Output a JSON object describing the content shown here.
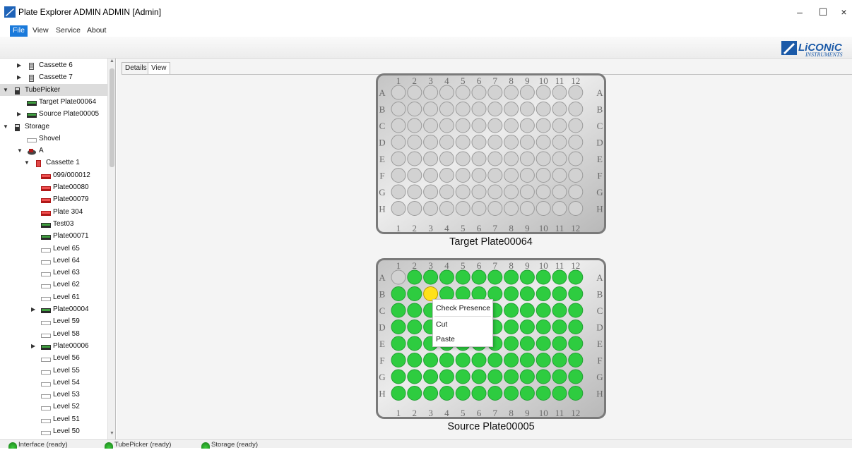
{
  "window": {
    "title": "Plate Explorer ADMIN ADMIN [Admin]",
    "minimize": "–",
    "maximize": "☐",
    "close": "×"
  },
  "menu": [
    "File",
    "View",
    "Service",
    "About"
  ],
  "logo": {
    "brand": "LiCONiC",
    "sub": "INSTRUMENTS"
  },
  "tree": [
    {
      "label": "Cassette 6",
      "level": 2,
      "arrow": "right",
      "icon": "cassette-icon"
    },
    {
      "label": "Cassette 7",
      "level": 2,
      "arrow": "right",
      "icon": "cassette-icon"
    },
    {
      "label": "TubePicker",
      "level": 1,
      "arrow": "down",
      "icon": "device-icon",
      "selected": true
    },
    {
      "label": "Target Plate00064",
      "level": 2,
      "arrow": "none",
      "icon": "plate-dark-icon"
    },
    {
      "label": "Source Plate00005",
      "level": 2,
      "arrow": "right",
      "icon": "plate-dark-icon"
    },
    {
      "label": "Storage",
      "level": 1,
      "arrow": "down",
      "icon": "device-icon"
    },
    {
      "label": "Shovel",
      "level": 2,
      "arrow": "none",
      "icon": "level-empty-icon"
    },
    {
      "label": "A",
      "level": 2,
      "arrow": "down",
      "icon": "carousel-icon"
    },
    {
      "label": "Cassette 1",
      "level": 3,
      "arrow": "down",
      "icon": "cassette-red-icon"
    },
    {
      "label": "099/000012",
      "level": 4,
      "arrow": "none",
      "icon": "plate-red-icon"
    },
    {
      "label": "Plate00080",
      "level": 4,
      "arrow": "none",
      "icon": "plate-red-icon"
    },
    {
      "label": "Plate00079",
      "level": 4,
      "arrow": "none",
      "icon": "plate-red-icon"
    },
    {
      "label": "Plate 304",
      "level": 4,
      "arrow": "none",
      "icon": "plate-red-icon"
    },
    {
      "label": "Test03",
      "level": 4,
      "arrow": "none",
      "icon": "plate-dark-icon"
    },
    {
      "label": "Plate00071",
      "level": 4,
      "arrow": "none",
      "icon": "plate-dark-icon"
    },
    {
      "label": "Level 65",
      "level": 4,
      "arrow": "none",
      "icon": "level-empty-icon"
    },
    {
      "label": "Level 64",
      "level": 4,
      "arrow": "none",
      "icon": "level-empty-icon"
    },
    {
      "label": "Level 63",
      "level": 4,
      "arrow": "none",
      "icon": "level-empty-icon"
    },
    {
      "label": "Level 62",
      "level": 4,
      "arrow": "none",
      "icon": "level-empty-icon"
    },
    {
      "label": "Level 61",
      "level": 4,
      "arrow": "none",
      "icon": "level-empty-icon"
    },
    {
      "label": "Plate00004",
      "level": 4,
      "arrow": "right",
      "icon": "plate-dark-icon"
    },
    {
      "label": "Level 59",
      "level": 4,
      "arrow": "none",
      "icon": "level-empty-icon"
    },
    {
      "label": "Level 58",
      "level": 4,
      "arrow": "none",
      "icon": "level-empty-icon"
    },
    {
      "label": "Plate00006",
      "level": 4,
      "arrow": "right",
      "icon": "plate-dark-icon"
    },
    {
      "label": "Level 56",
      "level": 4,
      "arrow": "none",
      "icon": "level-empty-icon"
    },
    {
      "label": "Level 55",
      "level": 4,
      "arrow": "none",
      "icon": "level-empty-icon"
    },
    {
      "label": "Level 54",
      "level": 4,
      "arrow": "none",
      "icon": "level-empty-icon"
    },
    {
      "label": "Level 53",
      "level": 4,
      "arrow": "none",
      "icon": "level-empty-icon"
    },
    {
      "label": "Level 52",
      "level": 4,
      "arrow": "none",
      "icon": "level-empty-icon"
    },
    {
      "label": "Level 51",
      "level": 4,
      "arrow": "none",
      "icon": "level-empty-icon"
    },
    {
      "label": "Level 50",
      "level": 4,
      "arrow": "none",
      "icon": "level-empty-icon"
    }
  ],
  "tabs": [
    {
      "label": "Details",
      "active": false
    },
    {
      "label": "View",
      "active": true
    }
  ],
  "plates": [
    {
      "name": "Target Plate00064",
      "rows": [
        "A",
        "B",
        "C",
        "D",
        "E",
        "F",
        "G",
        "H"
      ],
      "cols": [
        "1",
        "2",
        "3",
        "4",
        "5",
        "6",
        "7",
        "8",
        "9",
        "10",
        "11",
        "12"
      ],
      "wells": [
        "............",
        "............",
        "............",
        "............",
        "............",
        "............",
        "............",
        "............"
      ]
    },
    {
      "name": "Source Plate00005",
      "rows": [
        "A",
        "B",
        "C",
        "D",
        "E",
        "F",
        "G",
        "H"
      ],
      "cols": [
        "1",
        "2",
        "3",
        "4",
        "5",
        "6",
        "7",
        "8",
        "9",
        "10",
        "11",
        "12"
      ],
      "wells": [
        ".ggggggggggg",
        "ggyggggggggg",
        "gggggggggggg",
        "gggggggggggg",
        "gggggggggggg",
        "gggggggggggg",
        "gggggggggggg",
        "gggggggggggg"
      ]
    }
  ],
  "well_colors": {
    ".": "#d2d2d2",
    "g": "#2ecc40",
    "y": "#ffe11a"
  },
  "context_menu": [
    "Check Presence",
    "Cut",
    "Paste"
  ],
  "status": [
    {
      "label": "Interface (ready)"
    },
    {
      "label": "TubePicker (ready)"
    },
    {
      "label": "Storage (ready)"
    }
  ]
}
